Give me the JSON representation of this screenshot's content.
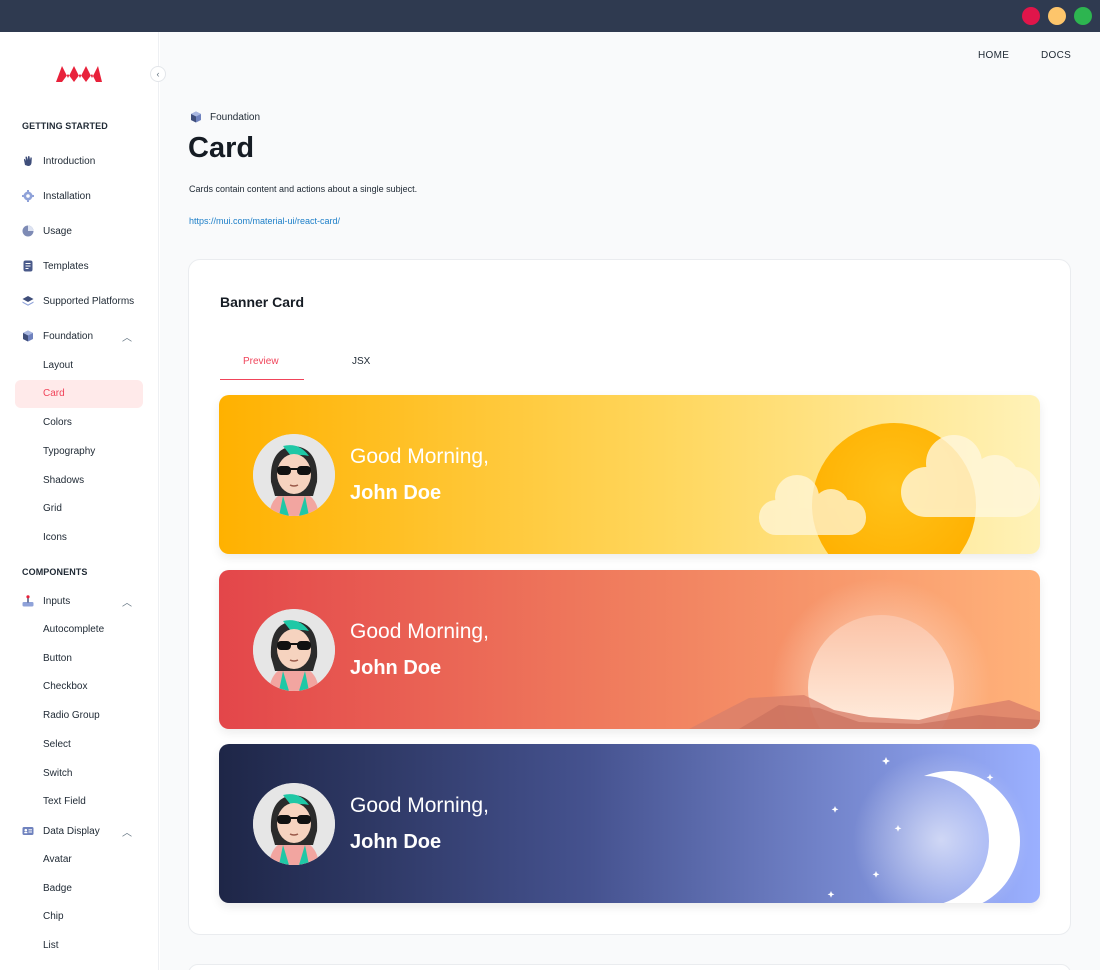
{
  "window": {
    "controls": [
      "close",
      "minimize",
      "maximize"
    ]
  },
  "sidebar": {
    "sections": [
      {
        "title": "GETTING STARTED"
      },
      {
        "title": "COMPONENTS"
      }
    ],
    "getting_started": [
      {
        "label": "Introduction",
        "icon": "hand-wave-icon"
      },
      {
        "label": "Installation",
        "icon": "gear-icon"
      },
      {
        "label": "Usage",
        "icon": "pie-chart-icon"
      },
      {
        "label": "Templates",
        "icon": "document-icon"
      },
      {
        "label": "Supported Platforms",
        "icon": "layers-icon"
      },
      {
        "label": "Foundation",
        "icon": "cube-icon"
      }
    ],
    "foundation_items": [
      "Layout",
      "Card",
      "Colors",
      "Typography",
      "Shadows",
      "Grid",
      "Icons"
    ],
    "inputs": {
      "label": "Inputs",
      "icon": "joystick-icon"
    },
    "inputs_items": [
      "Autocomplete",
      "Button",
      "Checkbox",
      "Radio Group",
      "Select",
      "Switch",
      "Text Field"
    ],
    "data_display": {
      "label": "Data Display",
      "icon": "id-card-icon"
    },
    "data_display_items": [
      "Avatar",
      "Badge",
      "Chip",
      "List"
    ],
    "active_item": "Card"
  },
  "header": {
    "home": "HOME",
    "docs": "DOCS"
  },
  "page": {
    "breadcrumb": "Foundation",
    "title": "Card",
    "description": "Cards contain content and actions about a single subject.",
    "link": "https://mui.com/material-ui/react-card/"
  },
  "panel": {
    "title": "Banner Card",
    "tabs": [
      "Preview",
      "JSX"
    ],
    "active_tab": "Preview"
  },
  "banners": [
    {
      "greeting": "Good Morning,",
      "name": "John Doe",
      "theme": "sunny"
    },
    {
      "greeting": "Good Morning,",
      "name": "John Doe",
      "theme": "sunset"
    },
    {
      "greeting": "Good Morning,",
      "name": "John Doe",
      "theme": "night"
    }
  ],
  "colors": {
    "accent": "#F0445A",
    "window_bar": "#2F3A50",
    "link": "#1D7FC8"
  }
}
